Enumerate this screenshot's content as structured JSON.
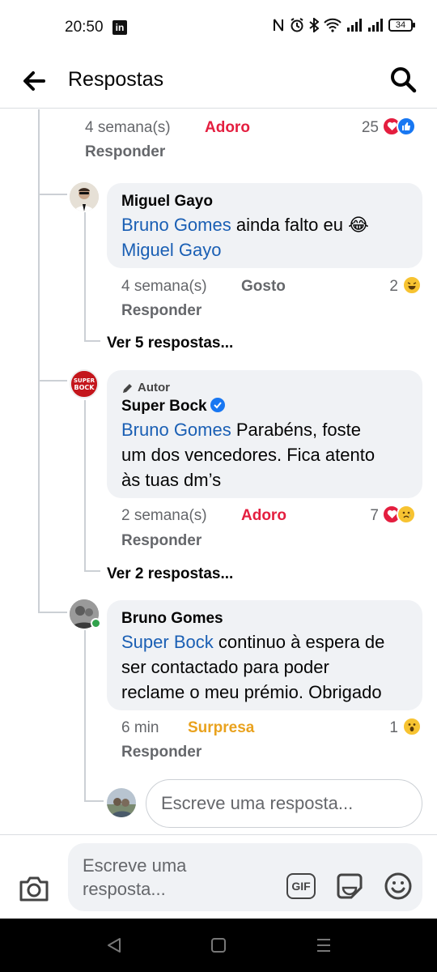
{
  "status_bar": {
    "time": "20:50",
    "app_badge": "in",
    "battery": "34",
    "icons": [
      "nfc-icon",
      "alarm-icon",
      "bluetooth-icon",
      "wifi-icon",
      "signal-icon",
      "signal-icon",
      "battery-icon"
    ]
  },
  "header": {
    "title": "Respostas",
    "back_icon": "arrow-left-icon",
    "search_icon": "search-icon"
  },
  "top_meta": {
    "time": "4 semana(s)",
    "reaction": "Adoro",
    "reply": "Responder",
    "count": "25",
    "reaction_icons": [
      "heart-icon",
      "like-icon"
    ]
  },
  "comments": [
    {
      "author": "Miguel Gayo",
      "mention": "Bruno Gomes",
      "text_line1": " ainda falto eu 😂",
      "text_line2": "Miguel Gayo",
      "time": "4 semana(s)",
      "reaction": "Gosto",
      "reply": "Responder",
      "count": "2",
      "reaction_icon": "laughing-icon",
      "view_replies": "Ver 5 respostas..."
    },
    {
      "badge": "Autor",
      "author": "Super Bock",
      "mention": "Bruno Gomes",
      "text_line1": " Parabéns, foste",
      "text_line2": "um dos vencedores. Fica atento",
      "text_line3": "às tuas dm’s",
      "time": "2 semana(s)",
      "reaction": "Adoro",
      "reply": "Responder",
      "count": "7",
      "reaction_icons": [
        "heart-icon",
        "sad-icon"
      ],
      "view_replies": "Ver 2 respostas...",
      "avatar_text_1": "SUPER",
      "avatar_text_2": "BOCK"
    },
    {
      "author": "Bruno Gomes",
      "mention": "Super Bock",
      "text_line1": " continuo à espera de",
      "text_line2": "ser contactado para poder",
      "text_line3": "reclame o meu prémio. Obrigado",
      "time": "6 min",
      "reaction": "Surpresa",
      "reply": "Responder",
      "count": "1",
      "reaction_icon": "wow-icon"
    }
  ],
  "reply_box": {
    "placeholder": "Escreve uma resposta..."
  },
  "composer": {
    "placeholder_line1": "Escreve uma",
    "placeholder_line2": "resposta...",
    "gif_label": "GIF",
    "icons": [
      "camera-icon",
      "gif-icon",
      "sticker-icon",
      "emoji-icon"
    ]
  },
  "colors": {
    "love": "#e41e3f",
    "wow": "#e9a21e",
    "mention": "#1a5fb4",
    "muted": "#65676b",
    "bubble": "#f0f2f5"
  }
}
